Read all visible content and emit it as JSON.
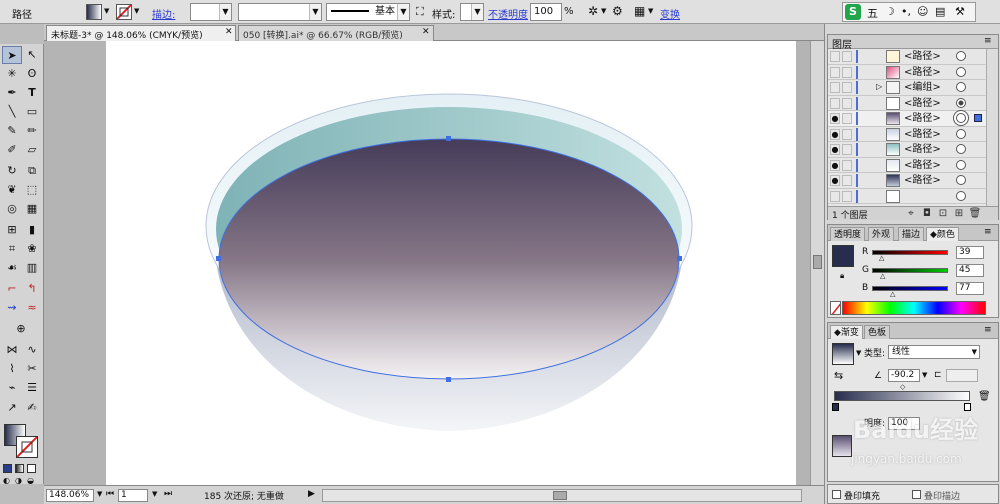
{
  "control_bar": {
    "object_type": "路径",
    "stroke_label": "描边:",
    "stroke_profile": "基本",
    "style_label": "样式:",
    "opacity_label": "不透明度",
    "opacity_value": "100",
    "opacity_unit": "%",
    "transform_label": "变换"
  },
  "ime_bar": {
    "logo": "S",
    "mode": "五"
  },
  "doc_tabs": [
    {
      "label": "未标题-3* @ 148.06% (CMYK/预览)",
      "active": true
    },
    {
      "label": "050 [转换].ai* @ 66.67% (RGB/预览)",
      "active": false
    }
  ],
  "status_bar": {
    "zoom": "148.06%",
    "artboard": "1",
    "status_text": "185 次还原; 无重做"
  },
  "layers_panel": {
    "title": "图层",
    "rows": [
      {
        "name": "<路径>",
        "visible": false,
        "target": "open",
        "arrow": false
      },
      {
        "name": "<路径>",
        "visible": false,
        "target": "open",
        "arrow": false
      },
      {
        "name": "<编组>",
        "visible": false,
        "target": "open",
        "arrow": true
      },
      {
        "name": "<路径>",
        "visible": false,
        "target": "filled",
        "arrow": false
      },
      {
        "name": "<路径>",
        "visible": true,
        "target": "selected",
        "arrow": false
      },
      {
        "name": "<路径>",
        "visible": true,
        "target": "open",
        "arrow": false
      },
      {
        "name": "<路径>",
        "visible": true,
        "target": "open",
        "arrow": false
      },
      {
        "name": "<路径>",
        "visible": true,
        "target": "open",
        "arrow": false
      },
      {
        "name": "<路径>",
        "visible": false,
        "target": "open",
        "arrow": false
      }
    ],
    "footer": "1 个图层"
  },
  "color_panel": {
    "tabs": [
      "透明度",
      "外观",
      "描边",
      "颜色"
    ],
    "active_tab": "颜色",
    "swatch_color": "#272d4d",
    "r_label": "R",
    "r_value": "39",
    "g_label": "G",
    "g_value": "45",
    "b_label": "B",
    "b_value": "77"
  },
  "gradient_panel": {
    "tabs": [
      "渐变",
      "色板"
    ],
    "type_label": "类型:",
    "type_value": "线性",
    "angle_value": "-90.2",
    "opacity_label_partial": "明度:",
    "opacity_value": "100"
  },
  "bottom_panel": {
    "fill_label": "叠印填充",
    "stroke_label": "叠印描边"
  },
  "watermark": {
    "text": "Baidu经验",
    "url": "jingyan.baidu.com"
  },
  "colors": {
    "accent": "#2a3bd0",
    "selection": "#3f6fe0"
  }
}
